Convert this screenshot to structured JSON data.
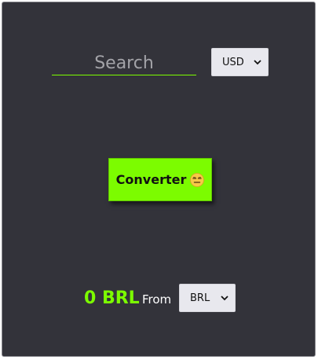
{
  "search": {
    "placeholder": "Search",
    "value": ""
  },
  "currency_select": {
    "selected": "USD",
    "icon": "chevron-down-icon"
  },
  "convert_button": {
    "label": "Converter",
    "icon": "expressionless-face-emoji"
  },
  "result": {
    "amount": "0 BRL",
    "from_label": "From"
  },
  "from_select": {
    "selected": "BRL",
    "icon": "chevron-down-icon"
  },
  "colors": {
    "background": "#33333a",
    "accent": "#7cfc00",
    "select_bg": "#e8e8ee",
    "text_light": "#ffffff"
  }
}
